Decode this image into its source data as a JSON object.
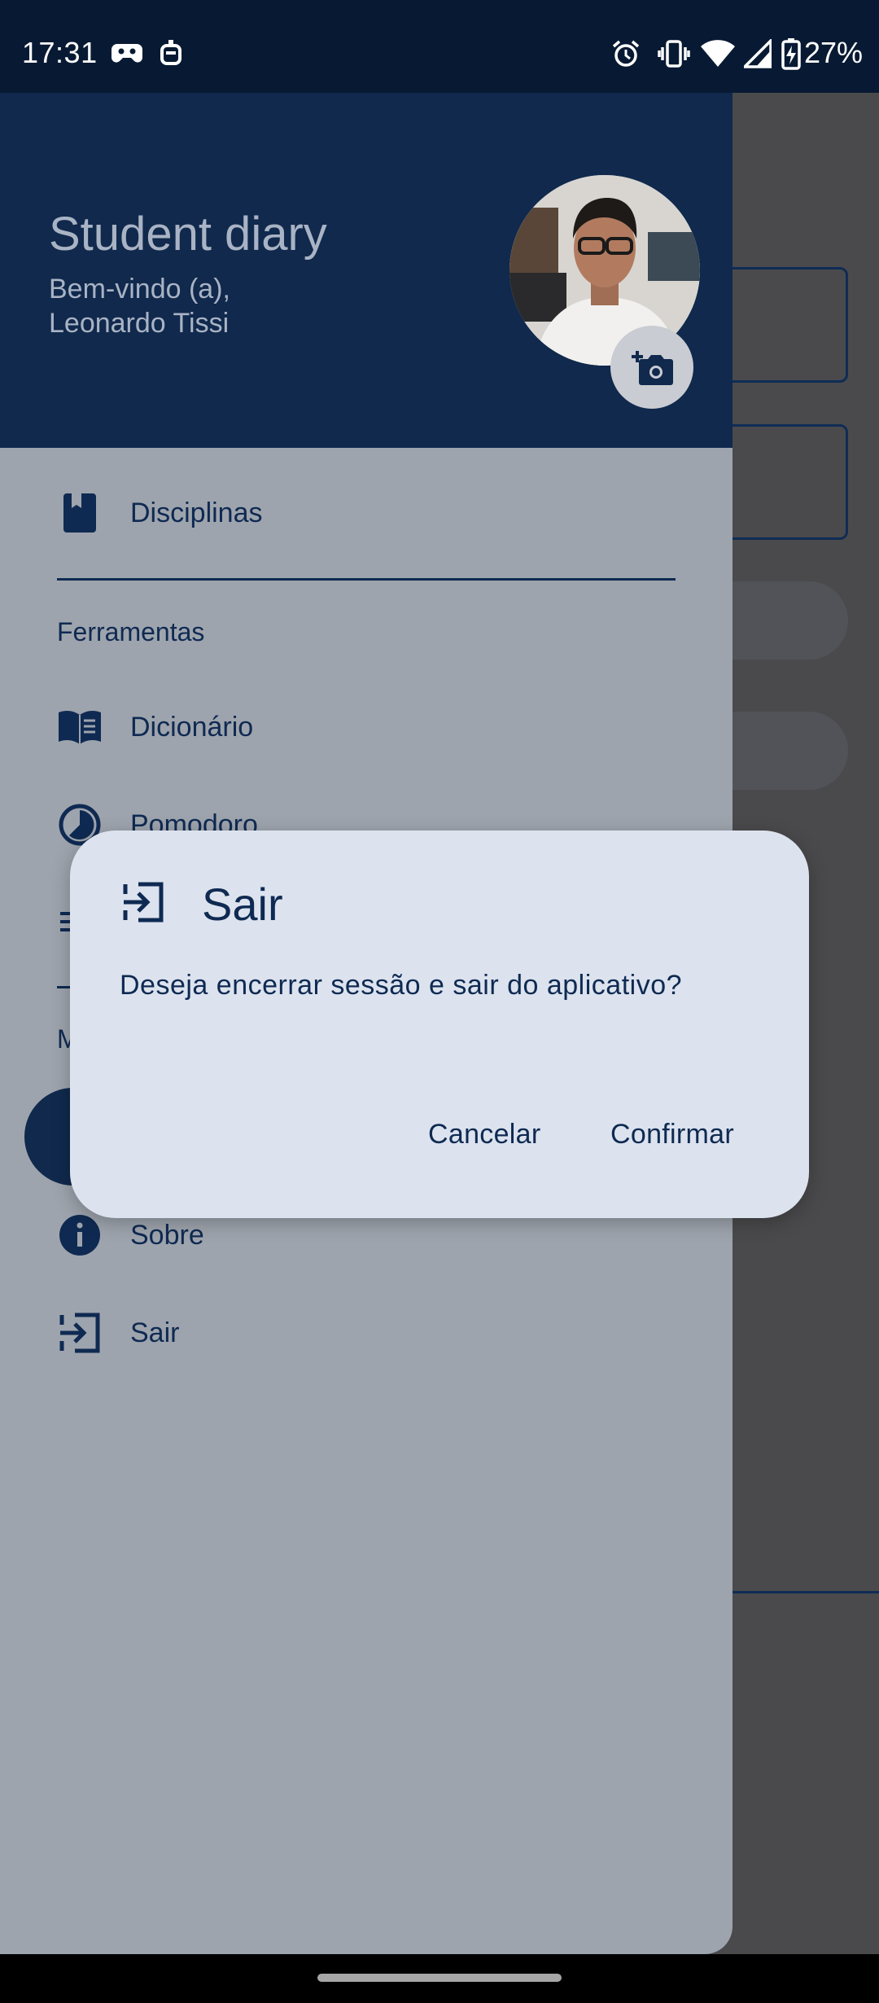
{
  "status_bar": {
    "time": "17:31",
    "battery": "27%",
    "left_icons": [
      "game-controller-icon",
      "robot-icon"
    ],
    "right_icons": [
      "alarm-icon",
      "vibrate-icon",
      "wifi-icon",
      "cell-signal-icon",
      "battery-charging-icon"
    ]
  },
  "drawer": {
    "header": {
      "title": "Student diary",
      "welcome_line1": "Bem-vindo (a),",
      "welcome_line2": "Leonardo Tissi"
    },
    "items": [
      {
        "label": "Disciplinas",
        "icon": "book-icon"
      },
      {
        "label": "Dicionário",
        "icon": "open-book-icon"
      },
      {
        "label": "Pomodoro",
        "icon": "timer-icon"
      },
      {
        "label": "Sobre",
        "icon": "info-icon"
      },
      {
        "label": "Sair",
        "icon": "logout-icon"
      }
    ],
    "sections": {
      "tools": "Ferramentas",
      "partial_second": "M"
    }
  },
  "dialog": {
    "title": "Sair",
    "icon": "logout-icon",
    "message": "Deseja encerrar sessão e sair do aplicativo?",
    "cancel": "Cancelar",
    "confirm": "Confirmar"
  },
  "colors": {
    "header_bg": "#10294d",
    "drawer_bg": "#9ea4ad",
    "dialog_bg": "#dce3ee",
    "accent": "#0f2a52",
    "status_bar_bg": "#081a33"
  }
}
